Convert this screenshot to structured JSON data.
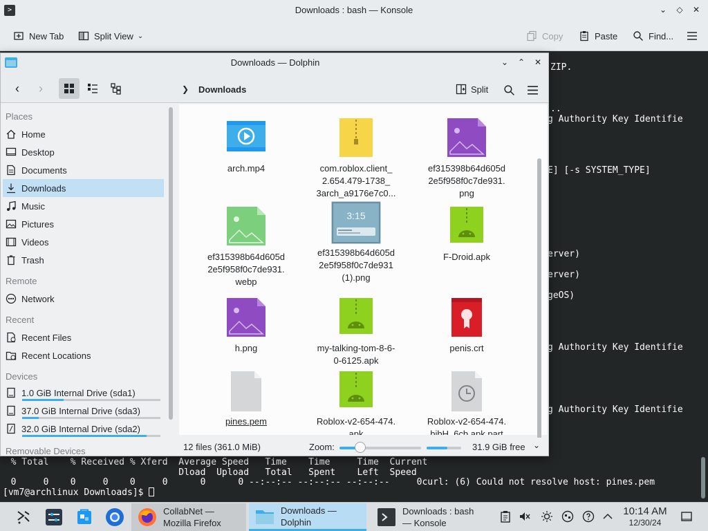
{
  "konsole": {
    "title": "Downloads : bash — Konsole",
    "toolbar": {
      "new_tab": "New Tab",
      "split_view": "Split View",
      "copy": "Copy",
      "paste": "Paste",
      "find": "Find..."
    },
    "terminal_lines": [
      "ZIP.",
      "..",
      "g Authority Key Identifie",
      "E] [-s SYSTEM_TYPE]",
      "erver)",
      "erver)",
      "geOS)",
      "g Authority Key Identifie",
      "g Authority Key Identifie"
    ],
    "curl_header_1": "  % Total    % Received % Xferd  Average Speed   Time    Time     Time  Current",
    "curl_header_2": "                                 Dload  Upload   Total   Spent    Left  Speed",
    "curl_progress": "  0     0    0     0    0     0      0      0 --:--:-- --:--:-- --:--:--     0curl: (6) Could not resolve host: pines.pem",
    "prompt": "[vm7@archlinux Downloads]$ "
  },
  "dolphin": {
    "title": "Downloads — Dolphin",
    "breadcrumb": "Downloads",
    "split_label": "Split",
    "sidebar": {
      "places_header": "Places",
      "places": [
        {
          "label": "Home",
          "icon": "home-icon"
        },
        {
          "label": "Desktop",
          "icon": "desktop-icon"
        },
        {
          "label": "Documents",
          "icon": "documents-icon"
        },
        {
          "label": "Downloads",
          "icon": "downloads-icon",
          "selected": true
        },
        {
          "label": "Music",
          "icon": "music-icon"
        },
        {
          "label": "Pictures",
          "icon": "pictures-icon"
        },
        {
          "label": "Videos",
          "icon": "videos-icon"
        },
        {
          "label": "Trash",
          "icon": "trash-icon"
        }
      ],
      "remote_header": "Remote",
      "remote": [
        {
          "label": "Network",
          "icon": "network-icon"
        }
      ],
      "recent_header": "Recent",
      "recent": [
        {
          "label": "Recent Files",
          "icon": "recent-files-icon"
        },
        {
          "label": "Recent Locations",
          "icon": "recent-locations-icon"
        }
      ],
      "devices_header": "Devices",
      "devices": [
        {
          "label": "1.0 GiB Internal Drive (sda1)",
          "usage": 0.3
        },
        {
          "label": "37.0 GiB Internal Drive (sda3)",
          "usage": 0.12
        },
        {
          "label": "32.0 GiB Internal Drive (sda2)",
          "usage": 0.9
        }
      ],
      "removable_header": "Removable Devices"
    },
    "files": [
      {
        "name": "arch.mp4",
        "type": "video"
      },
      {
        "name": "com.roblox.client_ 2.654.479-1738_ 3arch_a9176e7c0...",
        "type": "archive"
      },
      {
        "name": "ef315398b64d605d 2e5f958f0c7de931. png",
        "type": "image-purple"
      },
      {
        "name": "ef315398b64d605d 2e5f958f0c7de931. webp",
        "type": "image-green"
      },
      {
        "name": "ef315398b64d605d 2e5f958f0c7de931 (1).png",
        "type": "screenshot"
      },
      {
        "name": "F-Droid.apk",
        "type": "apk"
      },
      {
        "name": "h.png",
        "type": "image-purple"
      },
      {
        "name": "my-talking-tom-8-6- 0-6125.apk",
        "type": "apk-archive"
      },
      {
        "name": "penis.crt",
        "type": "certificate"
      },
      {
        "name": "pines.pem",
        "type": "blank"
      },
      {
        "name": "Roblox-v2-654-474. apk",
        "type": "apk-archive"
      },
      {
        "name": "Roblox-v2-654-474. bibH_6cb.apk.part",
        "type": "partial"
      }
    ],
    "status": {
      "count": "12 files (361.0 MiB)",
      "zoom_label": "Zoom:",
      "free": "31.9 GiB free",
      "zoom_level": 0.25,
      "space_used": 0.6
    }
  },
  "taskbar": {
    "tasks": [
      {
        "label_1": "CollabNet —",
        "label_2": "Mozilla Firefox"
      },
      {
        "label_1": "Downloads —",
        "label_2": "Dolphin"
      },
      {
        "label_1": "Downloads : bash",
        "label_2": "— Konsole"
      }
    ],
    "time": "10:14 AM",
    "date": "12/30/24"
  },
  "colors": {
    "accent": "#3daee9",
    "selection": "#c2e0f4",
    "terminal_bg": "#232627"
  }
}
